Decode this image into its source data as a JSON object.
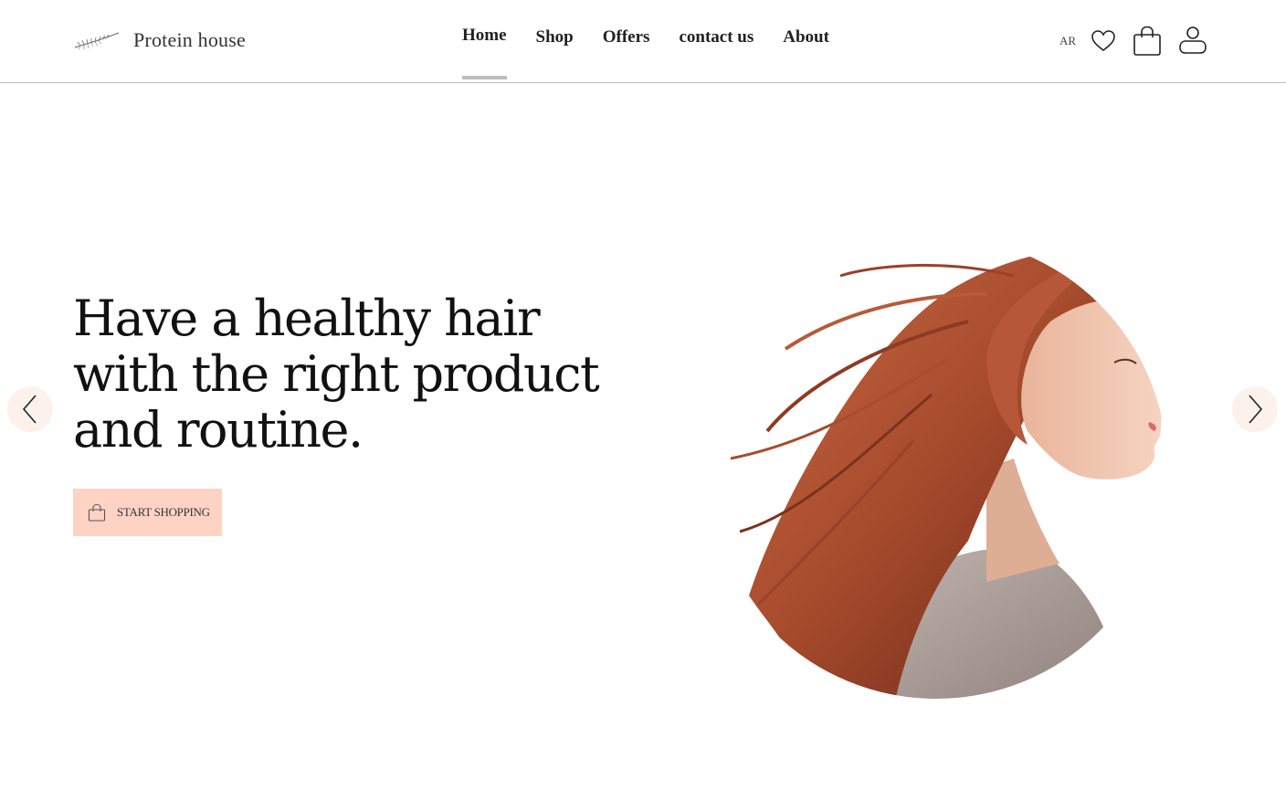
{
  "header": {
    "brand_name": "Protein house",
    "nav": [
      {
        "label": "Home",
        "active": true
      },
      {
        "label": "Shop"
      },
      {
        "label": "Offers"
      },
      {
        "label": "contact us"
      },
      {
        "label": "About"
      }
    ],
    "language": "AR"
  },
  "hero": {
    "title": "Have a healthy hair with the right product and routine.",
    "cta_label": "START SHOPPING"
  },
  "colors": {
    "accent": "#ffd3c3",
    "arrow_bg": "#fdf1ec",
    "nav_indicator": "#bdbdbd"
  },
  "icons": [
    "leaf-logo-icon",
    "heart-icon",
    "shopping-bag-icon",
    "user-icon",
    "chevron-left-icon",
    "chevron-right-icon"
  ]
}
